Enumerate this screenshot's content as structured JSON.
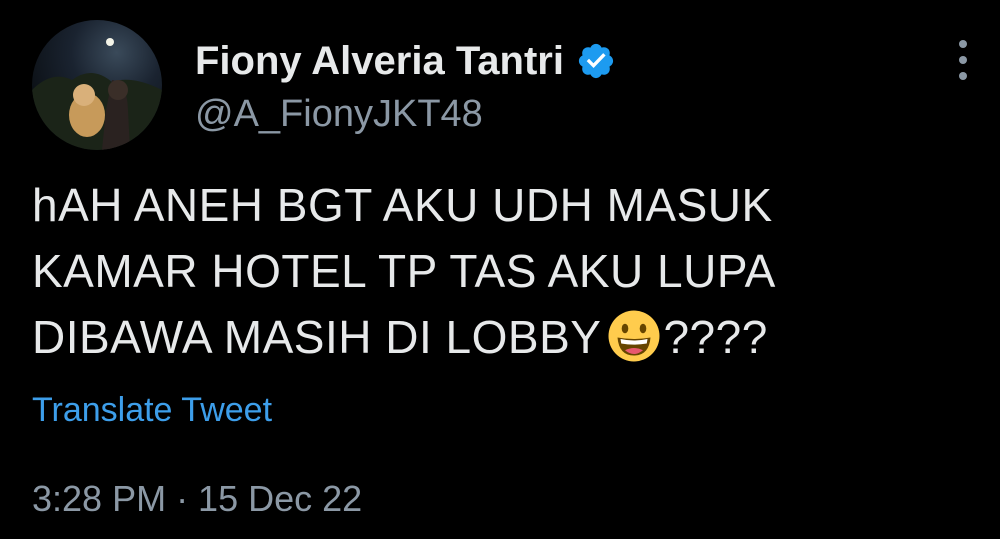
{
  "author": {
    "name": "Fiony Alveria Tantri",
    "handle": "@A_FionyJKT48",
    "verified": true,
    "avatar_icon": "profile-photo"
  },
  "tweet": {
    "lines": [
      "hAH ANEH BGT AKU UDH MASUK",
      "KAMAR HOTEL TP TAS AKU LUPA",
      "DIBAWA MASIH DI LOBBY"
    ],
    "emoji": "grinning-face-emoji",
    "trailing": "????",
    "translate_label": "Translate Tweet",
    "timestamp": "3:28 PM · 15 Dec 22"
  },
  "colors": {
    "background": "#000000",
    "text": "#e7e9ea",
    "secondary": "#8b98a5",
    "link": "#3d9eea",
    "verified": "#1d9bf0"
  },
  "menu_icon": "more-vertical-icon"
}
